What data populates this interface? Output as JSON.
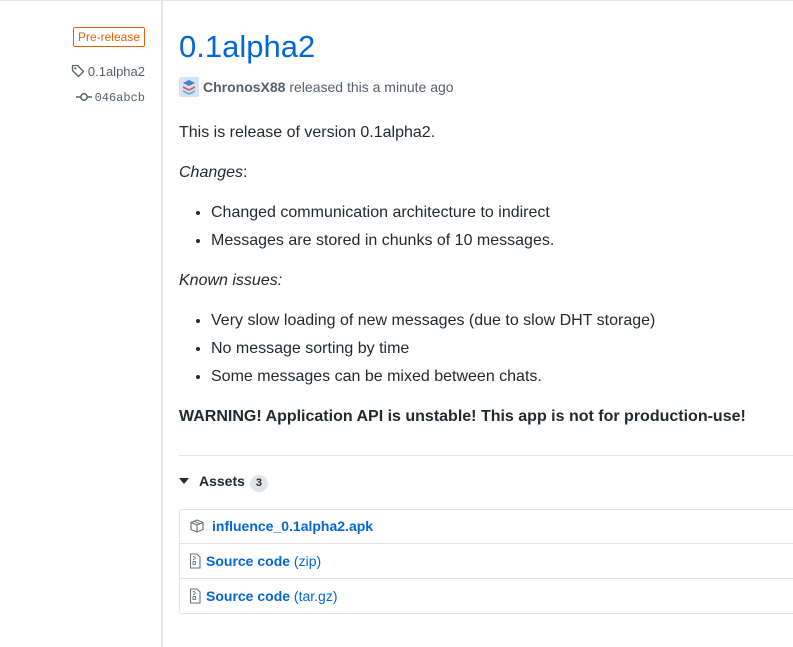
{
  "sidebar": {
    "prerelease_badge": "Pre-release",
    "tag": "0.1alpha2",
    "commit": "046abcb"
  },
  "release": {
    "title": "0.1alpha2",
    "author": "ChronosX88",
    "released_text": "released this a minute ago"
  },
  "notes": {
    "description": "This is release of version 0.1alpha2.",
    "changes_heading": "Changes",
    "changes_colon": ":",
    "changes": [
      "Changed communication architecture to indirect",
      "Messages are stored in chunks of 10 messages."
    ],
    "known_issues_heading": "Known issues:",
    "known_issues": [
      "Very slow loading of new messages (due to slow DHT storage)",
      "No message sorting by time",
      "Some messages can be mixed between chats."
    ],
    "warning": "WARNING! Application API is unstable! This app is not for production-use!"
  },
  "assets": {
    "label": "Assets",
    "count": "3",
    "items": [
      {
        "name": "influence_0.1alpha2.apk",
        "suffix": "",
        "icon": "package-icon"
      },
      {
        "name": "Source code",
        "suffix": "(zip)",
        "icon": "file-zip-icon"
      },
      {
        "name": "Source code",
        "suffix": "(tar.gz)",
        "icon": "file-zip-icon"
      }
    ]
  },
  "colors": {
    "link": "#0366d6",
    "prerelease": "#e36209",
    "muted": "#586069",
    "text": "#24292e",
    "border": "#e1e4e8"
  }
}
